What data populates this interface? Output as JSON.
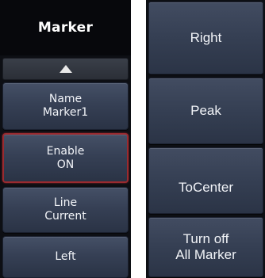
{
  "panel": {
    "title": "Marker",
    "scroll_up_icon": "triangle-up-icon",
    "buttons": [
      {
        "line1": "Name",
        "line2": "Marker1"
      },
      {
        "line1": "Enable",
        "line2": "ON"
      },
      {
        "line1": "Line",
        "line2": "Current"
      },
      {
        "line1": "Left",
        "line2": ""
      }
    ]
  },
  "side": {
    "buttons": [
      {
        "line1": "Right",
        "line2": ""
      },
      {
        "line1": "Peak",
        "line2": ""
      },
      {
        "line1": "ToCenter",
        "line2": ""
      },
      {
        "line1": "Turn off",
        "line2": "All Marker"
      }
    ]
  },
  "colors": {
    "background": "#0d0f14",
    "button": "#364055",
    "highlight_border": "#9a2a2f",
    "text": "#f2f4f8"
  }
}
